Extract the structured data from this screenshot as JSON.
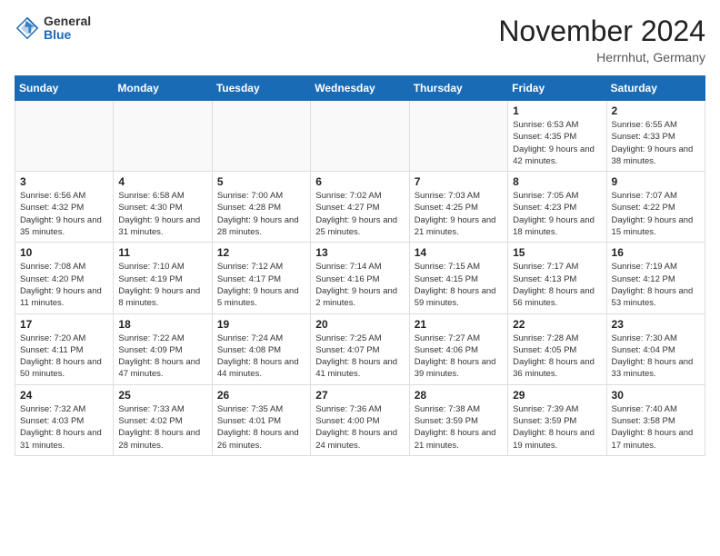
{
  "logo": {
    "general": "General",
    "blue": "Blue"
  },
  "title": "November 2024",
  "location": "Herrnhut, Germany",
  "weekdays": [
    "Sunday",
    "Monday",
    "Tuesday",
    "Wednesday",
    "Thursday",
    "Friday",
    "Saturday"
  ],
  "weeks": [
    [
      {
        "day": "",
        "info": ""
      },
      {
        "day": "",
        "info": ""
      },
      {
        "day": "",
        "info": ""
      },
      {
        "day": "",
        "info": ""
      },
      {
        "day": "",
        "info": ""
      },
      {
        "day": "1",
        "info": "Sunrise: 6:53 AM\nSunset: 4:35 PM\nDaylight: 9 hours and 42 minutes."
      },
      {
        "day": "2",
        "info": "Sunrise: 6:55 AM\nSunset: 4:33 PM\nDaylight: 9 hours and 38 minutes."
      }
    ],
    [
      {
        "day": "3",
        "info": "Sunrise: 6:56 AM\nSunset: 4:32 PM\nDaylight: 9 hours and 35 minutes."
      },
      {
        "day": "4",
        "info": "Sunrise: 6:58 AM\nSunset: 4:30 PM\nDaylight: 9 hours and 31 minutes."
      },
      {
        "day": "5",
        "info": "Sunrise: 7:00 AM\nSunset: 4:28 PM\nDaylight: 9 hours and 28 minutes."
      },
      {
        "day": "6",
        "info": "Sunrise: 7:02 AM\nSunset: 4:27 PM\nDaylight: 9 hours and 25 minutes."
      },
      {
        "day": "7",
        "info": "Sunrise: 7:03 AM\nSunset: 4:25 PM\nDaylight: 9 hours and 21 minutes."
      },
      {
        "day": "8",
        "info": "Sunrise: 7:05 AM\nSunset: 4:23 PM\nDaylight: 9 hours and 18 minutes."
      },
      {
        "day": "9",
        "info": "Sunrise: 7:07 AM\nSunset: 4:22 PM\nDaylight: 9 hours and 15 minutes."
      }
    ],
    [
      {
        "day": "10",
        "info": "Sunrise: 7:08 AM\nSunset: 4:20 PM\nDaylight: 9 hours and 11 minutes."
      },
      {
        "day": "11",
        "info": "Sunrise: 7:10 AM\nSunset: 4:19 PM\nDaylight: 9 hours and 8 minutes."
      },
      {
        "day": "12",
        "info": "Sunrise: 7:12 AM\nSunset: 4:17 PM\nDaylight: 9 hours and 5 minutes."
      },
      {
        "day": "13",
        "info": "Sunrise: 7:14 AM\nSunset: 4:16 PM\nDaylight: 9 hours and 2 minutes."
      },
      {
        "day": "14",
        "info": "Sunrise: 7:15 AM\nSunset: 4:15 PM\nDaylight: 8 hours and 59 minutes."
      },
      {
        "day": "15",
        "info": "Sunrise: 7:17 AM\nSunset: 4:13 PM\nDaylight: 8 hours and 56 minutes."
      },
      {
        "day": "16",
        "info": "Sunrise: 7:19 AM\nSunset: 4:12 PM\nDaylight: 8 hours and 53 minutes."
      }
    ],
    [
      {
        "day": "17",
        "info": "Sunrise: 7:20 AM\nSunset: 4:11 PM\nDaylight: 8 hours and 50 minutes."
      },
      {
        "day": "18",
        "info": "Sunrise: 7:22 AM\nSunset: 4:09 PM\nDaylight: 8 hours and 47 minutes."
      },
      {
        "day": "19",
        "info": "Sunrise: 7:24 AM\nSunset: 4:08 PM\nDaylight: 8 hours and 44 minutes."
      },
      {
        "day": "20",
        "info": "Sunrise: 7:25 AM\nSunset: 4:07 PM\nDaylight: 8 hours and 41 minutes."
      },
      {
        "day": "21",
        "info": "Sunrise: 7:27 AM\nSunset: 4:06 PM\nDaylight: 8 hours and 39 minutes."
      },
      {
        "day": "22",
        "info": "Sunrise: 7:28 AM\nSunset: 4:05 PM\nDaylight: 8 hours and 36 minutes."
      },
      {
        "day": "23",
        "info": "Sunrise: 7:30 AM\nSunset: 4:04 PM\nDaylight: 8 hours and 33 minutes."
      }
    ],
    [
      {
        "day": "24",
        "info": "Sunrise: 7:32 AM\nSunset: 4:03 PM\nDaylight: 8 hours and 31 minutes."
      },
      {
        "day": "25",
        "info": "Sunrise: 7:33 AM\nSunset: 4:02 PM\nDaylight: 8 hours and 28 minutes."
      },
      {
        "day": "26",
        "info": "Sunrise: 7:35 AM\nSunset: 4:01 PM\nDaylight: 8 hours and 26 minutes."
      },
      {
        "day": "27",
        "info": "Sunrise: 7:36 AM\nSunset: 4:00 PM\nDaylight: 8 hours and 24 minutes."
      },
      {
        "day": "28",
        "info": "Sunrise: 7:38 AM\nSunset: 3:59 PM\nDaylight: 8 hours and 21 minutes."
      },
      {
        "day": "29",
        "info": "Sunrise: 7:39 AM\nSunset: 3:59 PM\nDaylight: 8 hours and 19 minutes."
      },
      {
        "day": "30",
        "info": "Sunrise: 7:40 AM\nSunset: 3:58 PM\nDaylight: 8 hours and 17 minutes."
      }
    ]
  ]
}
